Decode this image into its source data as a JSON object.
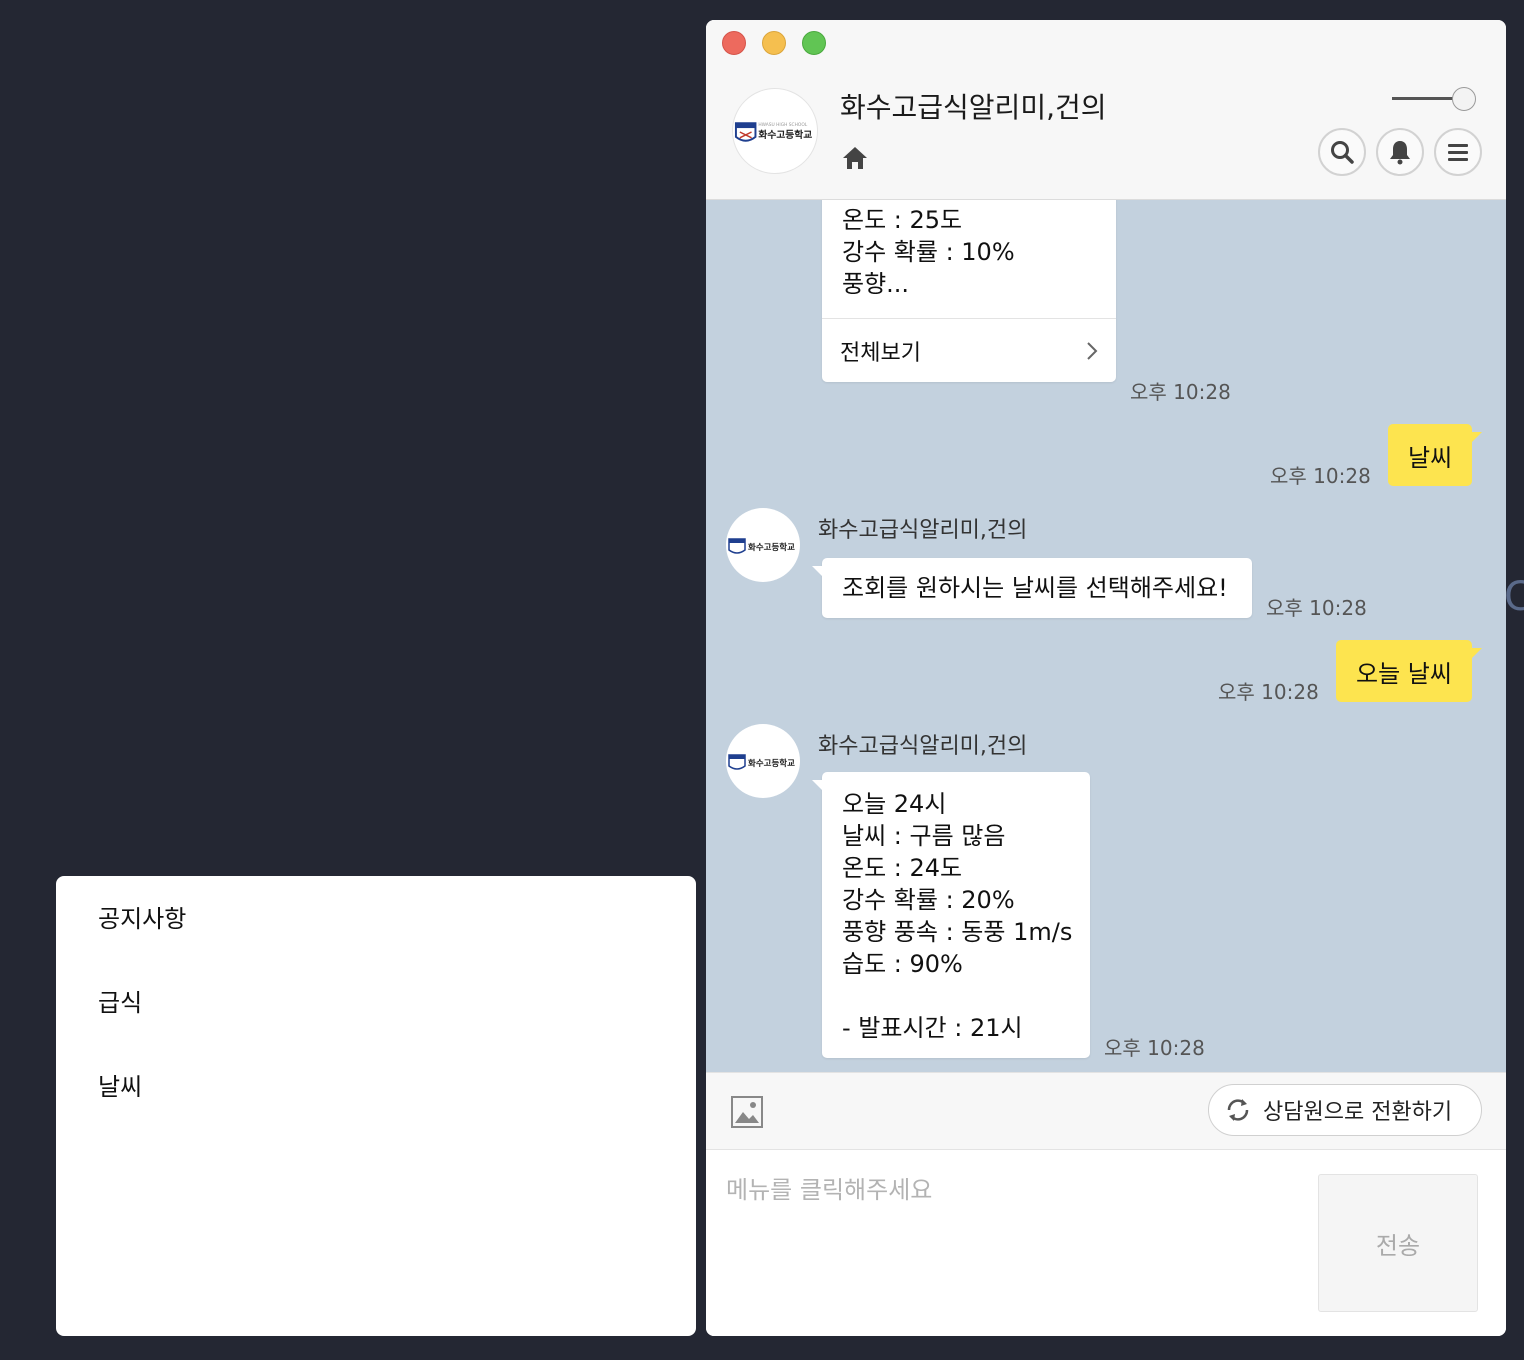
{
  "menu": {
    "items": [
      {
        "label": "공지사항"
      },
      {
        "label": "급식"
      },
      {
        "label": "날씨"
      }
    ]
  },
  "chat": {
    "title": "화수고급식알리미,건의",
    "logo_caption": "화수고등학교",
    "logo_subcaption": "HWASU HIGH SCHOOL",
    "messages": {
      "m1": {
        "text": "온도 : 25도\n강수 확률 : 10%\n풍향...",
        "view_all": "전체보기",
        "time": "오후 10:28"
      },
      "m2": {
        "text": "날씨",
        "time": "오후 10:28"
      },
      "m3": {
        "sender": "화수고급식알리미,건의",
        "text": "조회를 원하시는 날씨를 선택해주세요!",
        "time": "오후 10:28"
      },
      "m4": {
        "text": "오늘 날씨",
        "time": "오후 10:28"
      },
      "m5": {
        "sender": "화수고급식알리미,건의",
        "text": "오늘 24시\n날씨 : 구름 많음\n온도 : 24도\n강수 확률 : 20%\n풍향 풍속 : 동풍 1m/s\n습도 : 90%\n\n- 발표시간 : 21시",
        "time": "오후 10:28"
      }
    },
    "switch_label": "상담원으로 전환하기",
    "input_placeholder": "메뉴를 클릭해주세요",
    "send_label": "전송"
  },
  "colors": {
    "desktop": "#242733",
    "chat_bg": "#c3d1de",
    "user_bubble": "#fde44f"
  },
  "icons": [
    "home-icon",
    "search-icon",
    "bell-icon",
    "menu-icon",
    "image-icon",
    "refresh-icon"
  ]
}
